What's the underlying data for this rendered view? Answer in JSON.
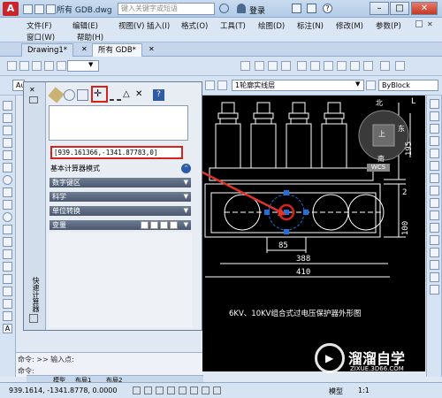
{
  "app": {
    "title": "所有 GDB.dwg",
    "search_placeholder": "键入关键字或短语",
    "login_label": "登录",
    "help_icon": "help-icon"
  },
  "menu": {
    "row1": [
      "文件(F)",
      "编辑(E)",
      "视图(V)",
      "插入(I)",
      "格式(O)",
      "工具(T)",
      "绘图(D)",
      "标注(N)",
      "修改(M)",
      "参数(P)"
    ],
    "row2": [
      "窗口(W)",
      "帮助(H)"
    ]
  },
  "tabs": [
    {
      "label": "Drawing1*"
    },
    {
      "label": "所有 GDB*"
    }
  ],
  "toolbar": {
    "layer_combo": "1轮廓实线层",
    "bylayer_combo": "ByBlock",
    "style_combo": "Au"
  },
  "calculator": {
    "result": "[939.161366,-1341.87783,0]",
    "basic_mode_label": "基本计算器模式",
    "sections": [
      "数字键区",
      "科学",
      "单位转换",
      "变量"
    ],
    "side_title": "快速计算器"
  },
  "drawing": {
    "title": "6KV、10KV组合式过电压保护器外形图",
    "dims": [
      "85",
      "388",
      "410",
      "195",
      "2",
      "100",
      "L"
    ],
    "viewcube": {
      "north": "北",
      "east": "东",
      "south": "南",
      "face": "上",
      "wcs": "WCS"
    }
  },
  "command": {
    "history": "命令: >> 输入点:",
    "prompt": "命令:"
  },
  "layout_tabs": [
    "模型",
    "布局1",
    "布局2"
  ],
  "status": {
    "coords": "939.1614, -1341.8778, 0.0000",
    "model_label": "模型",
    "scale_label": "1:1"
  },
  "watermark": {
    "brand": "溜溜自学",
    "url": "ZIXUE.3D66.COM"
  },
  "colors": {
    "highlight_red": "#d6221b",
    "canvas": "#000000",
    "grip_blue": "#1f6fe0"
  }
}
